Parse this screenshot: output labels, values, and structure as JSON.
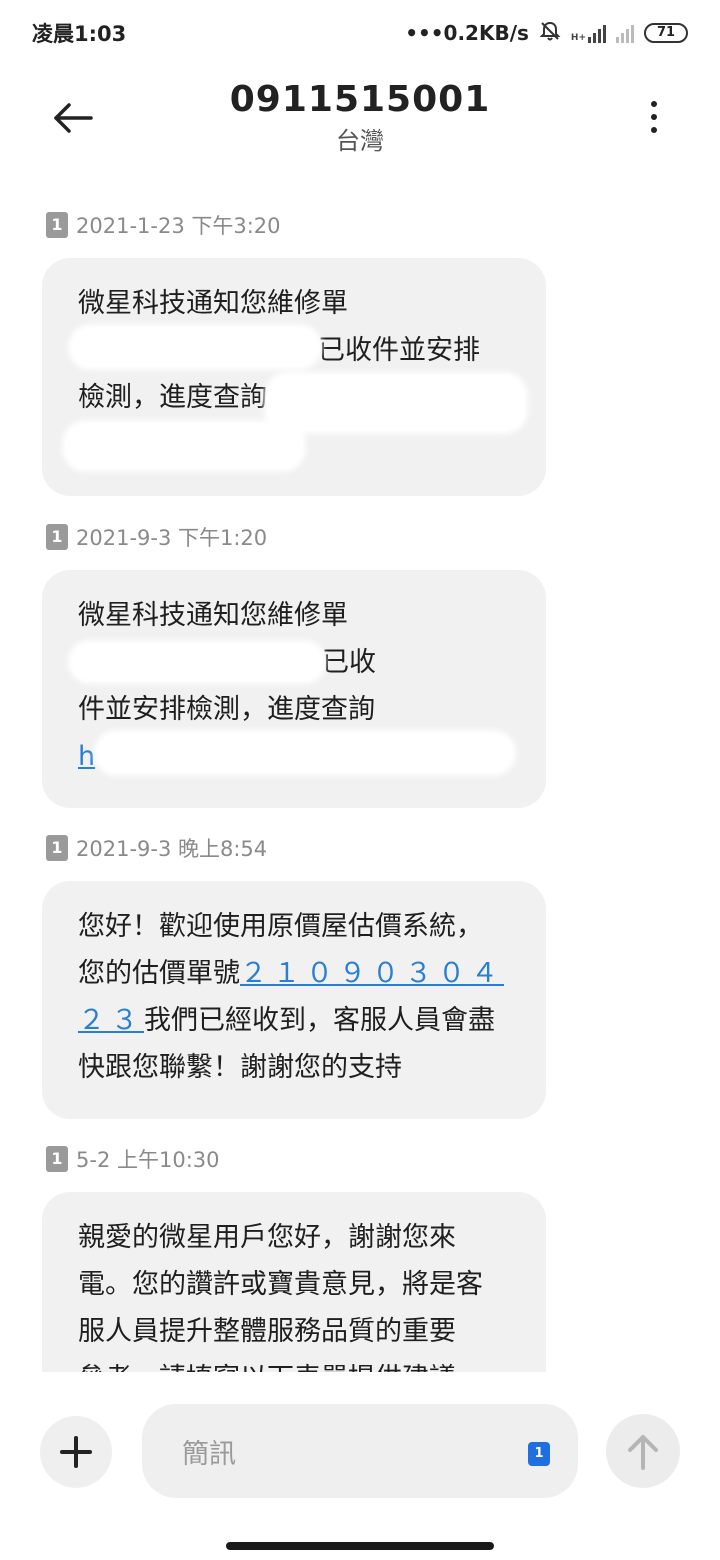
{
  "status_bar": {
    "time": "凌晨1:03",
    "network_speed": "•••0.2KB/s",
    "network_label": "H+",
    "battery": "71",
    "icons": [
      "bell-off-icon",
      "signal-icon",
      "signal-no-service-icon",
      "battery-icon"
    ]
  },
  "header": {
    "title": "0911515001",
    "subtitle": "台灣",
    "icons": [
      "back-arrow-icon",
      "more-vert-icon"
    ]
  },
  "messages": [
    {
      "sim": "1",
      "timestamp": "2021-1-23 下午3:20",
      "lines": [
        "微星科技通知您維修單",
        "已收件並安排",
        "檢測，進度查詢",
        ""
      ]
    },
    {
      "sim": "1",
      "timestamp": "2021-9-3 下午1:20",
      "lines": [
        "微星科技通知您維修單",
        "已收",
        "件並安排檢測，進度查詢",
        "h"
      ]
    },
    {
      "sim": "1",
      "timestamp": "2021-9-3 晚上8:54",
      "lines": [
        "您好！歡迎使用原價屋估價系統，",
        "您的估價單號",
        "我們已經收到，客服人員會盡",
        "快跟您聯繫！謝謝您的支持"
      ],
      "link_part1": "２１０９０３０４",
      "link_part2": "２３"
    },
    {
      "sim": "1",
      "timestamp": "5-2 上午10:30",
      "lines": [
        "親愛的微星用戶您好，謝謝您來",
        "電。您的讚許或寶貴意見，將是客",
        "服人員提升整體服務品質的重要",
        "參考。請填寫以下表單提供建議。"
      ]
    }
  ],
  "compose": {
    "placeholder": "簡訊",
    "sim": "1",
    "icons": [
      "plus-icon",
      "send-arrow-up-icon"
    ]
  },
  "colors": {
    "bubble": "#f1f1f1",
    "link": "#2a7fd4",
    "sim_badge": "#9a9a9a",
    "sim_select": "#1f6fe0"
  }
}
